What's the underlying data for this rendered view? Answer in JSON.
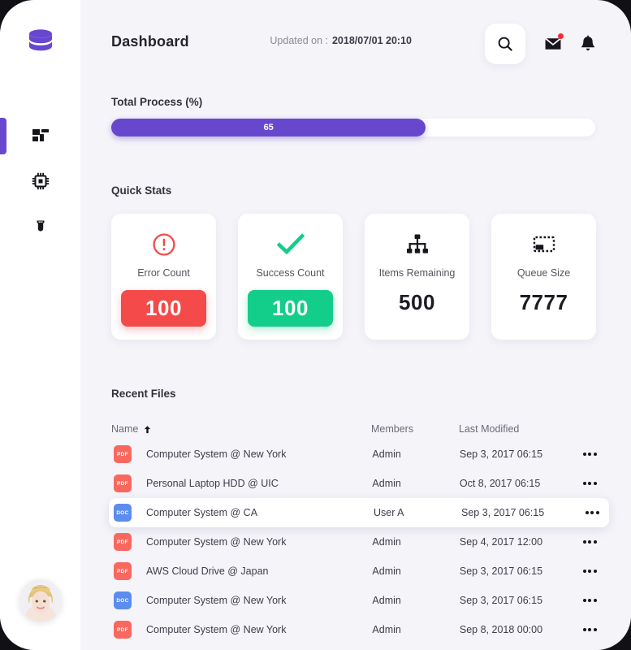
{
  "sidebar": {
    "logo": {
      "icon": "database-icon",
      "color": "#6847cf"
    },
    "items": [
      {
        "icon": "dashboard-grid-icon",
        "label": "Dashboard",
        "active": true
      },
      {
        "icon": "cpu-chip-icon",
        "label": "Devices",
        "active": false
      },
      {
        "icon": "plug-connector-icon",
        "label": "Connections",
        "active": false
      }
    ],
    "avatar": {
      "name": "user-avatar",
      "alt": "User profile photo"
    }
  },
  "header": {
    "title": "Dashboard",
    "updated_label": "Updated on :",
    "updated_value": "2018/07/01 20:10",
    "search_icon": "search-icon",
    "mail_icon": "mail-icon",
    "mail_has_badge": true,
    "bell_icon": "bell-icon"
  },
  "progress": {
    "title": "Total Process (%)",
    "value": 65,
    "value_label": "65",
    "max": 100,
    "fill_color": "#6847cf",
    "track_color": "#ffffff"
  },
  "quick_stats": {
    "title": "Quick Stats",
    "cards": [
      {
        "label": "Error Count",
        "value": "100",
        "icon": "error-exclamation-icon",
        "style": "pill-red",
        "color": "#f44a4a"
      },
      {
        "label": "Success Count",
        "value": "100",
        "icon": "success-check-icon",
        "style": "pill-green",
        "color": "#13cd8a"
      },
      {
        "label": "Items Remaining",
        "value": "500",
        "icon": "sitemap-icon",
        "style": "plain",
        "color": "#1d1c23"
      },
      {
        "label": "Queue Size",
        "value": "7777",
        "icon": "selection-box-icon",
        "style": "plain",
        "color": "#1d1c23"
      }
    ]
  },
  "recent_files": {
    "title": "Recent Files",
    "columns": [
      "Name",
      "Members",
      "Last Modified"
    ],
    "sort_column": "Name",
    "sort_direction": "asc",
    "sort_icon": "arrow-up-icon",
    "row_action_icon": "more-options-icon",
    "rows": [
      {
        "type": "PDF",
        "name": "Computer System @ New York",
        "members": "Admin",
        "modified": "Sep 3, 2017 06:15",
        "selected": false
      },
      {
        "type": "PDF",
        "name": "Personal Laptop HDD @ UIC",
        "members": "Admin",
        "modified": "Oct 8, 2017 06:15",
        "selected": false
      },
      {
        "type": "DOC",
        "name": "Computer System @ CA",
        "members": "User A",
        "modified": "Sep 3, 2017 06:15",
        "selected": true
      },
      {
        "type": "PDF",
        "name": "Computer System @ New York",
        "members": "Admin",
        "modified": "Sep 4, 2017 12:00",
        "selected": false
      },
      {
        "type": "PDF",
        "name": "AWS Cloud Drive @ Japan",
        "members": "Admin",
        "modified": "Sep 3, 2017 06:15",
        "selected": false
      },
      {
        "type": "DOC",
        "name": "Computer System @ New York",
        "members": "Admin",
        "modified": "Sep 3, 2017 06:15",
        "selected": false
      },
      {
        "type": "PDF",
        "name": "Computer System @ New York",
        "members": "Admin",
        "modified": "Sep 8, 2018 00:00",
        "selected": false
      }
    ]
  }
}
